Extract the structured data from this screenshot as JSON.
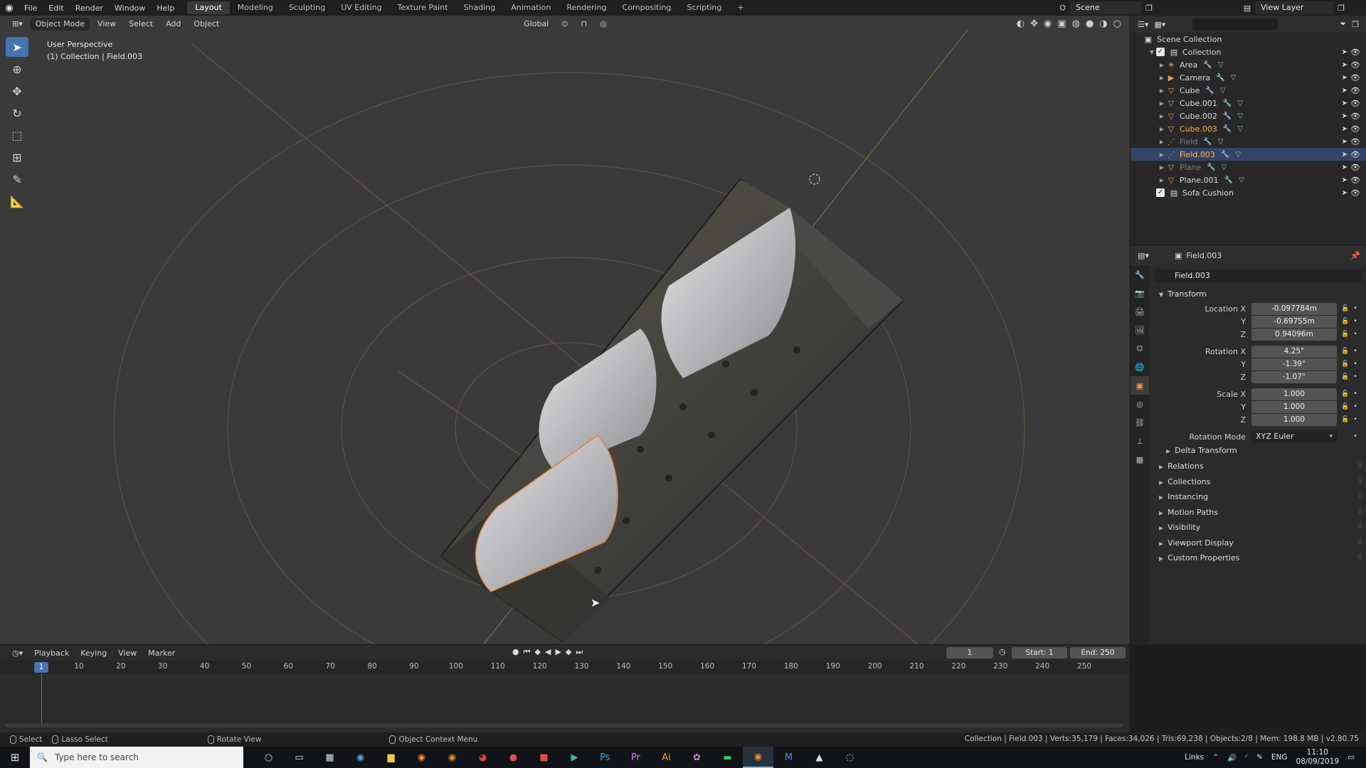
{
  "menu": {
    "items": [
      "File",
      "Edit",
      "Render",
      "Window",
      "Help"
    ],
    "workspaces": [
      "Layout",
      "Modeling",
      "Sculpting",
      "UV Editing",
      "Texture Paint",
      "Shading",
      "Animation",
      "Rendering",
      "Compositing",
      "Scripting"
    ],
    "active_workspace": "Layout",
    "scene": "Scene",
    "view_layer": "View Layer"
  },
  "viewport": {
    "mode": "Object Mode",
    "menus": [
      "View",
      "Select",
      "Add",
      "Object"
    ],
    "orientation": "Global",
    "info_line1": "User Perspective",
    "info_line2": "(1) Collection | Field.003"
  },
  "outliner": {
    "root": "Scene Collection",
    "collection": "Collection",
    "items": [
      {
        "name": "Area",
        "state": "normal",
        "icon": "light-icon"
      },
      {
        "name": "Camera",
        "state": "normal",
        "icon": "camera-icon"
      },
      {
        "name": "Cube",
        "state": "normal",
        "icon": "mesh-icon"
      },
      {
        "name": "Cube.001",
        "state": "normal",
        "icon": "mesh-icon"
      },
      {
        "name": "Cube.002",
        "state": "normal",
        "icon": "mesh-icon"
      },
      {
        "name": "Cube.003",
        "state": "active",
        "icon": "mesh-icon"
      },
      {
        "name": "Field",
        "state": "dim",
        "icon": "force-field-icon"
      },
      {
        "name": "Field.003",
        "state": "selected",
        "icon": "force-field-icon"
      },
      {
        "name": "Plane",
        "state": "dim",
        "icon": "mesh-icon"
      },
      {
        "name": "Plane.001",
        "state": "normal",
        "icon": "mesh-icon"
      }
    ],
    "sofa": "Sofa Cushion"
  },
  "properties": {
    "header_object": "Field.003",
    "object_name": "Field.003",
    "transform_title": "Transform",
    "location_label": "Location X",
    "rotation_label": "Rotation X",
    "scale_label": "Scale X",
    "y_label": "Y",
    "z_label": "Z",
    "location": [
      "-0.097784m",
      "-0.69755m",
      "0.94096m"
    ],
    "rotation": [
      "4.25°",
      "-1.39°",
      "-1.07°"
    ],
    "scale": [
      "1.000",
      "1.000",
      "1.000"
    ],
    "rotation_mode_label": "Rotation Mode",
    "rotation_mode": "XYZ Euler",
    "delta_transform": "Delta Transform",
    "panels": [
      "Relations",
      "Collections",
      "Instancing",
      "Motion Paths",
      "Visibility",
      "Viewport Display",
      "Custom Properties"
    ]
  },
  "timeline": {
    "menus": [
      "Playback",
      "Keying",
      "View",
      "Marker"
    ],
    "current_frame": "1",
    "start_label": "Start:",
    "start": "1",
    "end_label": "End:",
    "end": "250",
    "ticks": [
      "10",
      "20",
      "30",
      "40",
      "50",
      "60",
      "70",
      "80",
      "90",
      "100",
      "110",
      "120",
      "130",
      "140",
      "150",
      "160",
      "170",
      "180",
      "190",
      "200",
      "210",
      "220",
      "230",
      "240",
      "250"
    ],
    "playhead_label": "1"
  },
  "status": {
    "select": "Select",
    "lasso": "Lasso Select",
    "rotate": "Rotate View",
    "context": "Object Context Menu",
    "stats": "Collection | Field.003 | Verts:35,179 | Faces:34,026 | Tris:69,238 | Objects:2/8 | Mem: 198.8 MB | v2.80.75"
  },
  "taskbar": {
    "search_placeholder": "Type here to search",
    "links": "Links",
    "lang": "ENG",
    "time": "11:10",
    "date": "08/09/2019"
  }
}
